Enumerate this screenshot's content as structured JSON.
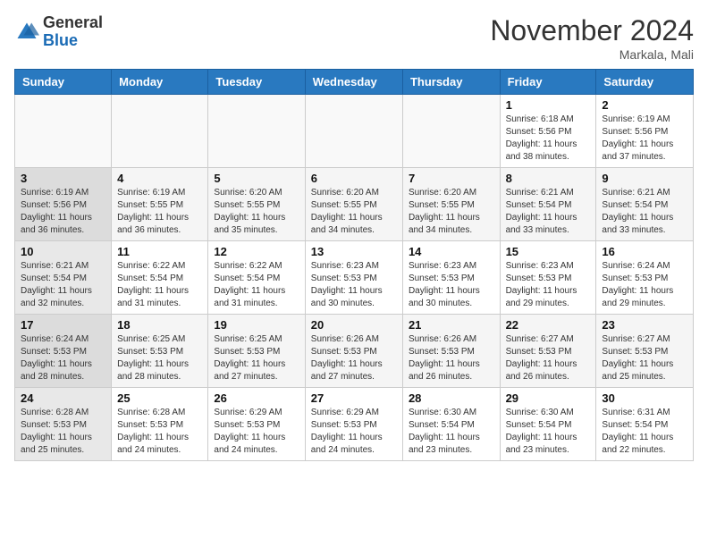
{
  "header": {
    "logo_general": "General",
    "logo_blue": "Blue",
    "month_title": "November 2024",
    "location": "Markala, Mali"
  },
  "days_of_week": [
    "Sunday",
    "Monday",
    "Tuesday",
    "Wednesday",
    "Thursday",
    "Friday",
    "Saturday"
  ],
  "weeks": [
    [
      {
        "day": "",
        "info": ""
      },
      {
        "day": "",
        "info": ""
      },
      {
        "day": "",
        "info": ""
      },
      {
        "day": "",
        "info": ""
      },
      {
        "day": "",
        "info": ""
      },
      {
        "day": "1",
        "info": "Sunrise: 6:18 AM\nSunset: 5:56 PM\nDaylight: 11 hours\nand 38 minutes."
      },
      {
        "day": "2",
        "info": "Sunrise: 6:19 AM\nSunset: 5:56 PM\nDaylight: 11 hours\nand 37 minutes."
      }
    ],
    [
      {
        "day": "3",
        "info": "Sunrise: 6:19 AM\nSunset: 5:56 PM\nDaylight: 11 hours\nand 36 minutes."
      },
      {
        "day": "4",
        "info": "Sunrise: 6:19 AM\nSunset: 5:55 PM\nDaylight: 11 hours\nand 36 minutes."
      },
      {
        "day": "5",
        "info": "Sunrise: 6:20 AM\nSunset: 5:55 PM\nDaylight: 11 hours\nand 35 minutes."
      },
      {
        "day": "6",
        "info": "Sunrise: 6:20 AM\nSunset: 5:55 PM\nDaylight: 11 hours\nand 34 minutes."
      },
      {
        "day": "7",
        "info": "Sunrise: 6:20 AM\nSunset: 5:55 PM\nDaylight: 11 hours\nand 34 minutes."
      },
      {
        "day": "8",
        "info": "Sunrise: 6:21 AM\nSunset: 5:54 PM\nDaylight: 11 hours\nand 33 minutes."
      },
      {
        "day": "9",
        "info": "Sunrise: 6:21 AM\nSunset: 5:54 PM\nDaylight: 11 hours\nand 33 minutes."
      }
    ],
    [
      {
        "day": "10",
        "info": "Sunrise: 6:21 AM\nSunset: 5:54 PM\nDaylight: 11 hours\nand 32 minutes."
      },
      {
        "day": "11",
        "info": "Sunrise: 6:22 AM\nSunset: 5:54 PM\nDaylight: 11 hours\nand 31 minutes."
      },
      {
        "day": "12",
        "info": "Sunrise: 6:22 AM\nSunset: 5:54 PM\nDaylight: 11 hours\nand 31 minutes."
      },
      {
        "day": "13",
        "info": "Sunrise: 6:23 AM\nSunset: 5:53 PM\nDaylight: 11 hours\nand 30 minutes."
      },
      {
        "day": "14",
        "info": "Sunrise: 6:23 AM\nSunset: 5:53 PM\nDaylight: 11 hours\nand 30 minutes."
      },
      {
        "day": "15",
        "info": "Sunrise: 6:23 AM\nSunset: 5:53 PM\nDaylight: 11 hours\nand 29 minutes."
      },
      {
        "day": "16",
        "info": "Sunrise: 6:24 AM\nSunset: 5:53 PM\nDaylight: 11 hours\nand 29 minutes."
      }
    ],
    [
      {
        "day": "17",
        "info": "Sunrise: 6:24 AM\nSunset: 5:53 PM\nDaylight: 11 hours\nand 28 minutes."
      },
      {
        "day": "18",
        "info": "Sunrise: 6:25 AM\nSunset: 5:53 PM\nDaylight: 11 hours\nand 28 minutes."
      },
      {
        "day": "19",
        "info": "Sunrise: 6:25 AM\nSunset: 5:53 PM\nDaylight: 11 hours\nand 27 minutes."
      },
      {
        "day": "20",
        "info": "Sunrise: 6:26 AM\nSunset: 5:53 PM\nDaylight: 11 hours\nand 27 minutes."
      },
      {
        "day": "21",
        "info": "Sunrise: 6:26 AM\nSunset: 5:53 PM\nDaylight: 11 hours\nand 26 minutes."
      },
      {
        "day": "22",
        "info": "Sunrise: 6:27 AM\nSunset: 5:53 PM\nDaylight: 11 hours\nand 26 minutes."
      },
      {
        "day": "23",
        "info": "Sunrise: 6:27 AM\nSunset: 5:53 PM\nDaylight: 11 hours\nand 25 minutes."
      }
    ],
    [
      {
        "day": "24",
        "info": "Sunrise: 6:28 AM\nSunset: 5:53 PM\nDaylight: 11 hours\nand 25 minutes."
      },
      {
        "day": "25",
        "info": "Sunrise: 6:28 AM\nSunset: 5:53 PM\nDaylight: 11 hours\nand 24 minutes."
      },
      {
        "day": "26",
        "info": "Sunrise: 6:29 AM\nSunset: 5:53 PM\nDaylight: 11 hours\nand 24 minutes."
      },
      {
        "day": "27",
        "info": "Sunrise: 6:29 AM\nSunset: 5:53 PM\nDaylight: 11 hours\nand 24 minutes."
      },
      {
        "day": "28",
        "info": "Sunrise: 6:30 AM\nSunset: 5:54 PM\nDaylight: 11 hours\nand 23 minutes."
      },
      {
        "day": "29",
        "info": "Sunrise: 6:30 AM\nSunset: 5:54 PM\nDaylight: 11 hours\nand 23 minutes."
      },
      {
        "day": "30",
        "info": "Sunrise: 6:31 AM\nSunset: 5:54 PM\nDaylight: 11 hours\nand 22 minutes."
      }
    ]
  ]
}
